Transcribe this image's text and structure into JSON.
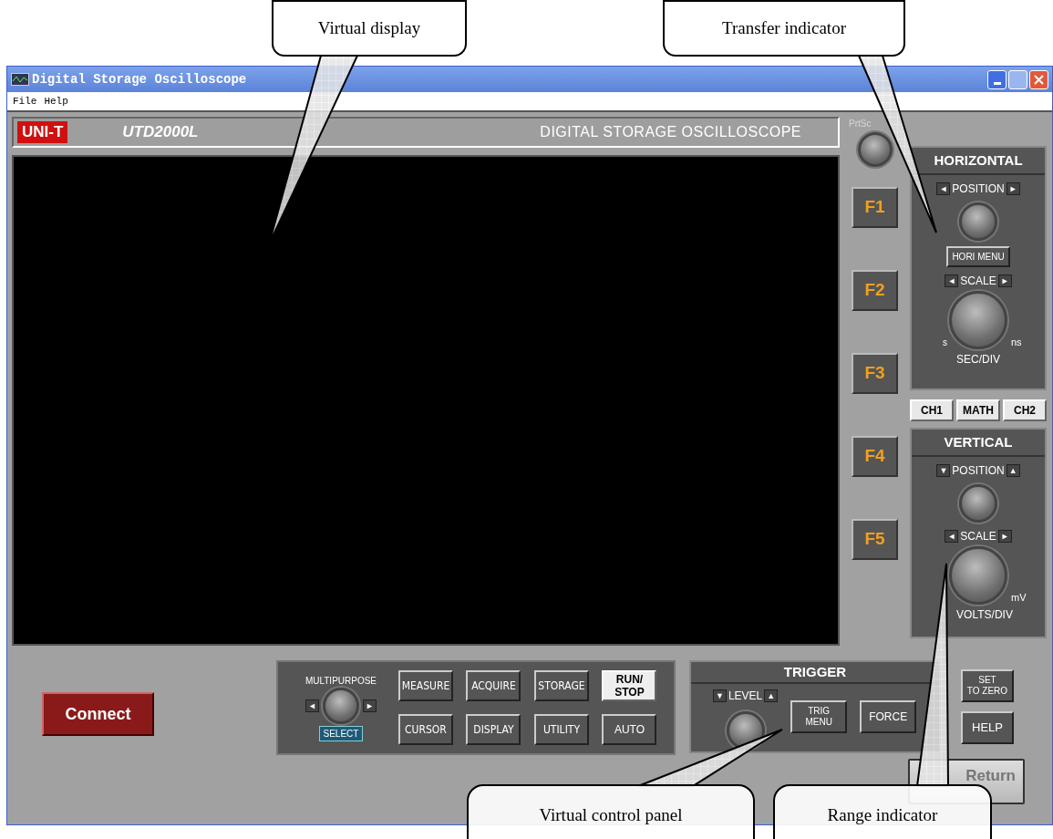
{
  "window": {
    "title": "Digital Storage Oscilloscope"
  },
  "menu": [
    "File",
    "Help"
  ],
  "header": {
    "brand": "UNI-T",
    "model": "UTD2000L",
    "caption": "DIGITAL STORAGE OSCILLOSCOPE"
  },
  "side": {
    "knob_label": "PrtSc",
    "function_keys": [
      "F1",
      "F2",
      "F3",
      "F4",
      "F5"
    ]
  },
  "horizontal": {
    "title": "HORIZONTAL",
    "position": {
      "left": "◄",
      "label": "POSITION",
      "right": "►"
    },
    "menu_button": "HORI MENU",
    "scale": {
      "left": "◄",
      "label": "SCALE",
      "right": "►"
    },
    "knob_left": "s",
    "knob_right": "ns",
    "unit": "SEC/DIV"
  },
  "channels": [
    "CH1",
    "MATH",
    "CH2"
  ],
  "vertical": {
    "title": "VERTICAL",
    "position": {
      "left": "▼",
      "label": "POSITION",
      "right": "▲"
    },
    "scale": {
      "left": "◄",
      "label": "SCALE",
      "right": "►"
    },
    "knob_right": "mV",
    "unit": "VOLTS/DIV"
  },
  "connect": "Connect",
  "multipurpose": {
    "label": "MULTIPURPOSE",
    "left": "◄",
    "right": "►",
    "select": "SELECT"
  },
  "buttons": [
    {
      "label": "MEASURE",
      "kind": "menu"
    },
    {
      "label": "ACQUIRE",
      "kind": "menu"
    },
    {
      "label": "STORAGE",
      "kind": "menu"
    },
    {
      "label": "RUN/\nSTOP",
      "kind": "light"
    },
    {
      "label": "CURSOR",
      "kind": "menu"
    },
    {
      "label": "DISPLAY",
      "kind": "menu"
    },
    {
      "label": "UTILITY",
      "kind": "menu"
    },
    {
      "label": "AUTO",
      "kind": "plain"
    }
  ],
  "trigger": {
    "title": "TRIGGER",
    "level": {
      "left": "▼",
      "label": "LEVEL",
      "right": "▲"
    },
    "buttons": [
      "TRIG\nMENU",
      "FORCE"
    ]
  },
  "side_buttons": [
    "SET\nTO ZERO",
    "HELP"
  ],
  "return": "Return",
  "callouts": [
    {
      "text": "Virtual display"
    },
    {
      "text": "Transfer indicator"
    },
    {
      "text": "Virtual control panel"
    },
    {
      "text": "Range indicator"
    }
  ]
}
